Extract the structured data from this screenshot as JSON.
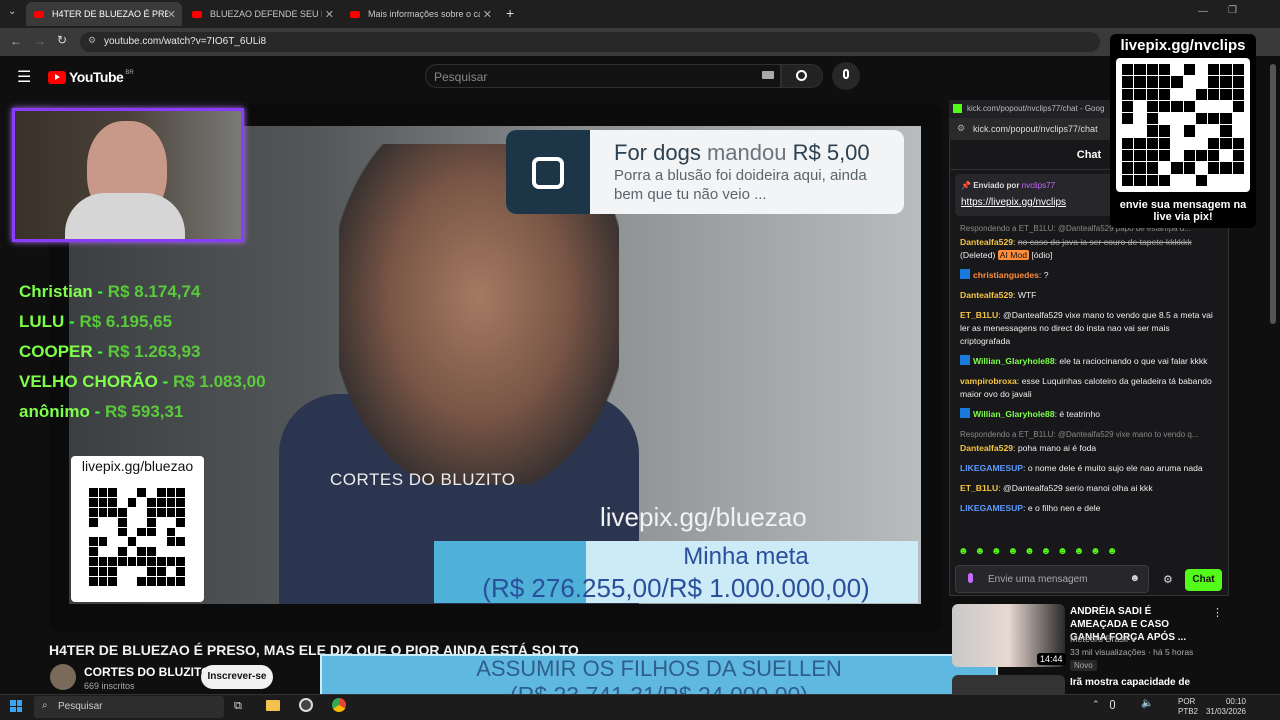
{
  "browser": {
    "tabs": [
      {
        "label": "H4TER DE BLUEZAO É PRES",
        "active": true
      },
      {
        "label": "BLUEZAO DEFENDE SEU FÃ, GA",
        "active": false
      },
      {
        "label": "Mais informações sobre o caso",
        "active": false
      }
    ],
    "new_tab": "+",
    "url": "youtube.com/watch?v=7IO6T_6ULi8"
  },
  "youtube": {
    "logo": "YouTube",
    "region": "BR",
    "search_placeholder": "Pesquisar"
  },
  "overlay": {
    "donors": [
      {
        "name": "Christian",
        "value": "R$ 8.174,74"
      },
      {
        "name": "LULU",
        "value": "R$ 6.195,65"
      },
      {
        "name": "COOPER",
        "value": "R$ 1.263,93"
      },
      {
        "name": "VELHO CHORÃO",
        "value": "R$ 1.083,00"
      },
      {
        "name": "anônimo",
        "value": "R$ 593,31"
      }
    ],
    "qr_label": "livepix.gg/bluezao",
    "donation": {
      "name": "For dogs",
      "verb": "mandou",
      "amount": "R$ 5,00",
      "message": "Porra a blusão foi doideira aqui, ainda bem que tu não veio ..."
    },
    "watermark": "CORTES DO BLUZITO",
    "livepix": "livepix.gg/bluezao",
    "goal_title": "Minha meta",
    "goal_value": "(R$ 276.255,00/R$ 1.000.000,00)",
    "goal_progress": 0.276,
    "goal2_title": "ASSUMIR OS FILHOS DA SUELLEN",
    "goal2_value": "(R$ 23.741,31/R$ 24.000,00)",
    "goal2_progress": 0.989
  },
  "video": {
    "title": "H4TER DE BLUEZAO É PRESO, MAS ELE DIZ QUE O PIOR AINDA ESTÁ SOLTO",
    "channel": "CORTES DO BLUZITO",
    "subscribers": "669 inscritos",
    "subscribe_label": "Inscrever-se"
  },
  "chat": {
    "window_title": "kick.com/popout/nvclips77/chat - Goog",
    "url": "kick.com/popout/nvclips77/chat",
    "header": "Chat",
    "pinned_by_label": "Enviado por",
    "pinned_by_user": "nvclips77",
    "pinned_link": "https://livepix.gg/nvclips",
    "messages": [
      {
        "reply": "Respondendo a ET_B1LU: @Dantealfa529 papo de estampa d...",
        "user": "Dantealfa529",
        "user_color": "#f5c542",
        "text": "no caso do java ia ser couro de tapete kkkkkk",
        "deleted": "(Deleted)",
        "badge": "AI Mod",
        "tag": "[ódio]"
      },
      {
        "user": "christianguedes",
        "user_color": "#ff8d3a",
        "text": "?",
        "kick": true
      },
      {
        "user": "Dantealfa529",
        "user_color": "#f5c542",
        "text": "WTF"
      },
      {
        "user": "ET_B1LU",
        "user_color": "#f5c542",
        "text": "@Dantealfa529 vixe mano to vendo que 8.5 a meta vai ler as menessagens no direct do insta nao vai ser mais criptografada"
      },
      {
        "user": "Willian_Glaryhole88",
        "user_color": "#7dff4a",
        "text": "ele ta raciocinando o que vai falar kkkk",
        "kick": true
      },
      {
        "user": "vampirobroxa",
        "user_color": "#f5c542",
        "text": "esse Luquinhas caloteiro da geladeira tá babando maior ovo do javali"
      },
      {
        "user": "Willian_Glaryhole88",
        "user_color": "#7dff4a",
        "text": "é teatrinho",
        "kick": true
      },
      {
        "reply": "Respondendo a ET_B1LU: @Dantealfa529 vixe mano to vendo q...",
        "user": "Dantealfa529",
        "user_color": "#f5c542",
        "text": "poha mano ai é foda"
      },
      {
        "user": "LIKEGAMESUP",
        "user_color": "#5b9bff",
        "text": "o nome dele é muito sujo ele nao aruma nada"
      },
      {
        "user": "ET_B1LU",
        "user_color": "#f5c542",
        "text": "@Dantealfa529 serio manoi olha ai kkk"
      },
      {
        "user": "LIKEGAMESUP",
        "user_color": "#5b9bff",
        "text": "e o filho nen e dele"
      }
    ],
    "emotes": "☻☻☻☻☻☻☻☻☻☻",
    "input_placeholder": "Envie uma mensagem",
    "send_label": "Chat"
  },
  "qr_overlay": {
    "label": "livepix.gg/nvclips",
    "caption": "envie sua mensagem na live via pix!"
  },
  "recommendations": [
    {
      "title": "ANDRÉIA SADI É AMEAÇADA E CASO GANHA FORÇA APÓS ...",
      "channel": "Meteoro Brasil",
      "meta": "33 mil visualizações · há 5 horas",
      "badge": "Novo",
      "duration": "14:44"
    },
    {
      "title": "Irã mostra capacidade de"
    }
  ],
  "taskbar": {
    "search_placeholder": "Pesquisar",
    "lang": "POR",
    "layout": "PTB2",
    "time": "00:10",
    "date": "31/03/2026"
  },
  "colors": {
    "accent_green": "#53fc18",
    "youtube_red": "#ff0000",
    "goal_blue": "#4fb0d8"
  }
}
